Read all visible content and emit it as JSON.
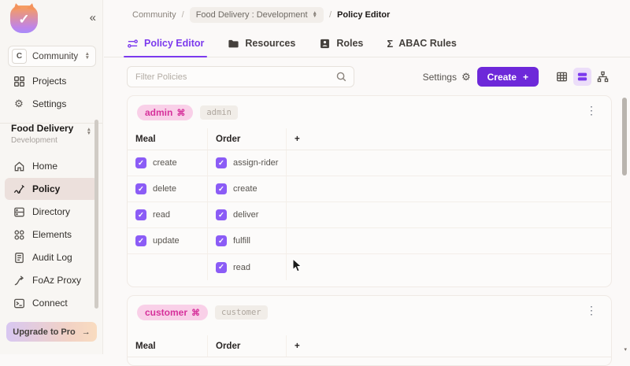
{
  "icons": {
    "collapse": "«",
    "logo_check": "✓",
    "kebab": "⋮",
    "role_glyph": "⌘",
    "plus": "+",
    "sigma": "Σ",
    "gear": "⚙",
    "scroll_arrow_down": "▾"
  },
  "sidebar": {
    "org": {
      "avatar_letter": "C",
      "name": "Community"
    },
    "primary_items": [
      {
        "label": "Projects"
      },
      {
        "label": "Settings"
      }
    ],
    "project": {
      "name": "Food Delivery",
      "environment": "Development"
    },
    "nav_items": [
      {
        "label": "Home"
      },
      {
        "label": "Policy"
      },
      {
        "label": "Directory"
      },
      {
        "label": "Elements"
      },
      {
        "label": "Audit Log"
      },
      {
        "label": "FoAz Proxy"
      },
      {
        "label": "Connect"
      }
    ],
    "upgrade": {
      "label": "Upgrade to Pro",
      "arrow": "→"
    }
  },
  "breadcrumb": {
    "root": "Community",
    "separator": "/",
    "context": "Food Delivery : Development",
    "current": "Policy Editor"
  },
  "tabs": [
    {
      "label": "Policy Editor"
    },
    {
      "label": "Resources"
    },
    {
      "label": "Roles"
    },
    {
      "label": "ABAC Rules"
    }
  ],
  "toolbar": {
    "filter_placeholder": "Filter Policies",
    "settings_label": "Settings",
    "create_label": "Create"
  },
  "policy_cards": [
    {
      "role_name": "admin",
      "role_key": "admin",
      "columns": [
        "Meal",
        "Order",
        "+"
      ],
      "rows": [
        {
          "meal": {
            "label": "create",
            "checked": true
          },
          "order": {
            "label": "assign-rider",
            "checked": true
          }
        },
        {
          "meal": {
            "label": "delete",
            "checked": true
          },
          "order": {
            "label": "create",
            "checked": true
          }
        },
        {
          "meal": {
            "label": "read",
            "checked": true
          },
          "order": {
            "label": "deliver",
            "checked": true
          }
        },
        {
          "meal": {
            "label": "update",
            "checked": true
          },
          "order": {
            "label": "fulfill",
            "checked": true
          }
        },
        {
          "meal": null,
          "order": {
            "label": "read",
            "checked": true
          }
        }
      ]
    },
    {
      "role_name": "customer",
      "role_key": "customer",
      "columns": [
        "Meal",
        "Order",
        "+"
      ],
      "rows": []
    }
  ],
  "colors": {
    "accent_purple": "#6d28d9",
    "checkbox_purple": "#8b5cf6",
    "active_tab_purple": "#7c3aed",
    "role_pill_bg": "#f9d0e8",
    "role_pill_text": "#d6319b",
    "sidebar_bg": "#f8f6f3",
    "content_bg": "#fbf9f8"
  }
}
